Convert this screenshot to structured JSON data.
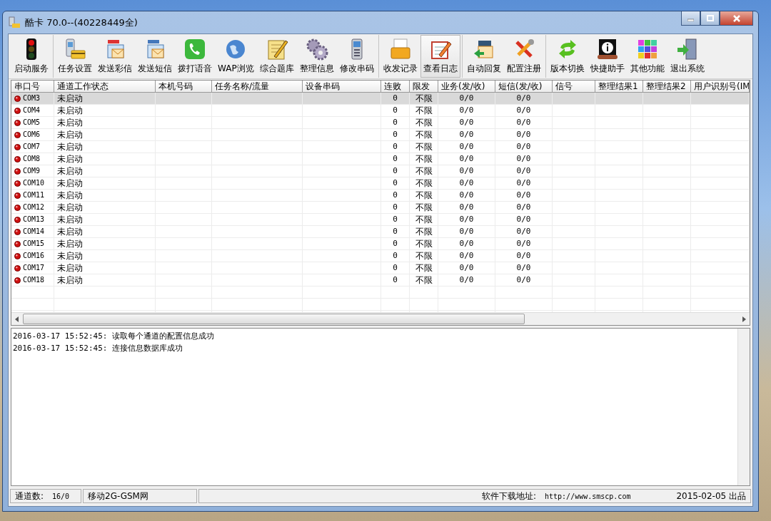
{
  "window": {
    "title": "酷卡 70.0--(40228449全)"
  },
  "toolbar": {
    "groups": [
      {
        "items": [
          {
            "label": "启动服务",
            "selected": false
          }
        ]
      },
      {
        "items": [
          {
            "label": "任务设置",
            "selected": false
          },
          {
            "label": "发送彩信",
            "selected": false
          },
          {
            "label": "发送短信",
            "selected": false
          },
          {
            "label": "拨打语音",
            "selected": false
          },
          {
            "label": "WAP浏览",
            "selected": false
          },
          {
            "label": "综合题库",
            "selected": false
          },
          {
            "label": "整理信息",
            "selected": false
          },
          {
            "label": "修改串码",
            "selected": false
          }
        ]
      },
      {
        "items": [
          {
            "label": "收发记录",
            "selected": false
          },
          {
            "label": "查看日志",
            "selected": true
          }
        ]
      },
      {
        "items": [
          {
            "label": "自动回复",
            "selected": false
          },
          {
            "label": "配置注册",
            "selected": false
          }
        ]
      },
      {
        "items": [
          {
            "label": "版本切换",
            "selected": false
          },
          {
            "label": "快捷助手",
            "selected": false
          },
          {
            "label": "其他功能",
            "selected": false
          },
          {
            "label": "退出系统",
            "selected": false
          }
        ]
      }
    ]
  },
  "table": {
    "columns": [
      "串口号",
      "通道工作状态",
      "本机号码",
      "任务名称/流量",
      "设备串码",
      "连败",
      "限发",
      "业务(发/收)",
      "短信(发/收)",
      "信号",
      "整理结果1",
      "整理结果2",
      "用户识别号(IM"
    ],
    "rows": [
      {
        "port": "COM3",
        "status": "未启动",
        "fails": "0",
        "limit": "不限",
        "business": "0/0",
        "sms": "0/0",
        "selected": true
      },
      {
        "port": "COM4",
        "status": "未启动",
        "fails": "0",
        "limit": "不限",
        "business": "0/0",
        "sms": "0/0",
        "selected": false
      },
      {
        "port": "COM5",
        "status": "未启动",
        "fails": "0",
        "limit": "不限",
        "business": "0/0",
        "sms": "0/0",
        "selected": false
      },
      {
        "port": "COM6",
        "status": "未启动",
        "fails": "0",
        "limit": "不限",
        "business": "0/0",
        "sms": "0/0",
        "selected": false
      },
      {
        "port": "COM7",
        "status": "未启动",
        "fails": "0",
        "limit": "不限",
        "business": "0/0",
        "sms": "0/0",
        "selected": false
      },
      {
        "port": "COM8",
        "status": "未启动",
        "fails": "0",
        "limit": "不限",
        "business": "0/0",
        "sms": "0/0",
        "selected": false
      },
      {
        "port": "COM9",
        "status": "未启动",
        "fails": "0",
        "limit": "不限",
        "business": "0/0",
        "sms": "0/0",
        "selected": false
      },
      {
        "port": "COM10",
        "status": "未启动",
        "fails": "0",
        "limit": "不限",
        "business": "0/0",
        "sms": "0/0",
        "selected": false
      },
      {
        "port": "COM11",
        "status": "未启动",
        "fails": "0",
        "limit": "不限",
        "business": "0/0",
        "sms": "0/0",
        "selected": false
      },
      {
        "port": "COM12",
        "status": "未启动",
        "fails": "0",
        "limit": "不限",
        "business": "0/0",
        "sms": "0/0",
        "selected": false
      },
      {
        "port": "COM13",
        "status": "未启动",
        "fails": "0",
        "limit": "不限",
        "business": "0/0",
        "sms": "0/0",
        "selected": false
      },
      {
        "port": "COM14",
        "status": "未启动",
        "fails": "0",
        "limit": "不限",
        "business": "0/0",
        "sms": "0/0",
        "selected": false
      },
      {
        "port": "COM15",
        "status": "未启动",
        "fails": "0",
        "limit": "不限",
        "business": "0/0",
        "sms": "0/0",
        "selected": false
      },
      {
        "port": "COM16",
        "status": "未启动",
        "fails": "0",
        "limit": "不限",
        "business": "0/0",
        "sms": "0/0",
        "selected": false
      },
      {
        "port": "COM17",
        "status": "未启动",
        "fails": "0",
        "limit": "不限",
        "business": "0/0",
        "sms": "0/0",
        "selected": false
      },
      {
        "port": "COM18",
        "status": "未启动",
        "fails": "0",
        "limit": "不限",
        "business": "0/0",
        "sms": "0/0",
        "selected": false
      }
    ]
  },
  "log": [
    "2016-03-17 15:52:45: 读取每个通道的配置信息成功",
    "2016-03-17 15:52:45: 连接信息数据库成功"
  ],
  "status_bar": {
    "channels_label": "通道数:",
    "channels_value": "16/0",
    "network": "移动2G-GSM网",
    "download_label": "软件下载地址:",
    "download_url": "http://www.smscp.com",
    "release": "2015-02-05 出品"
  }
}
